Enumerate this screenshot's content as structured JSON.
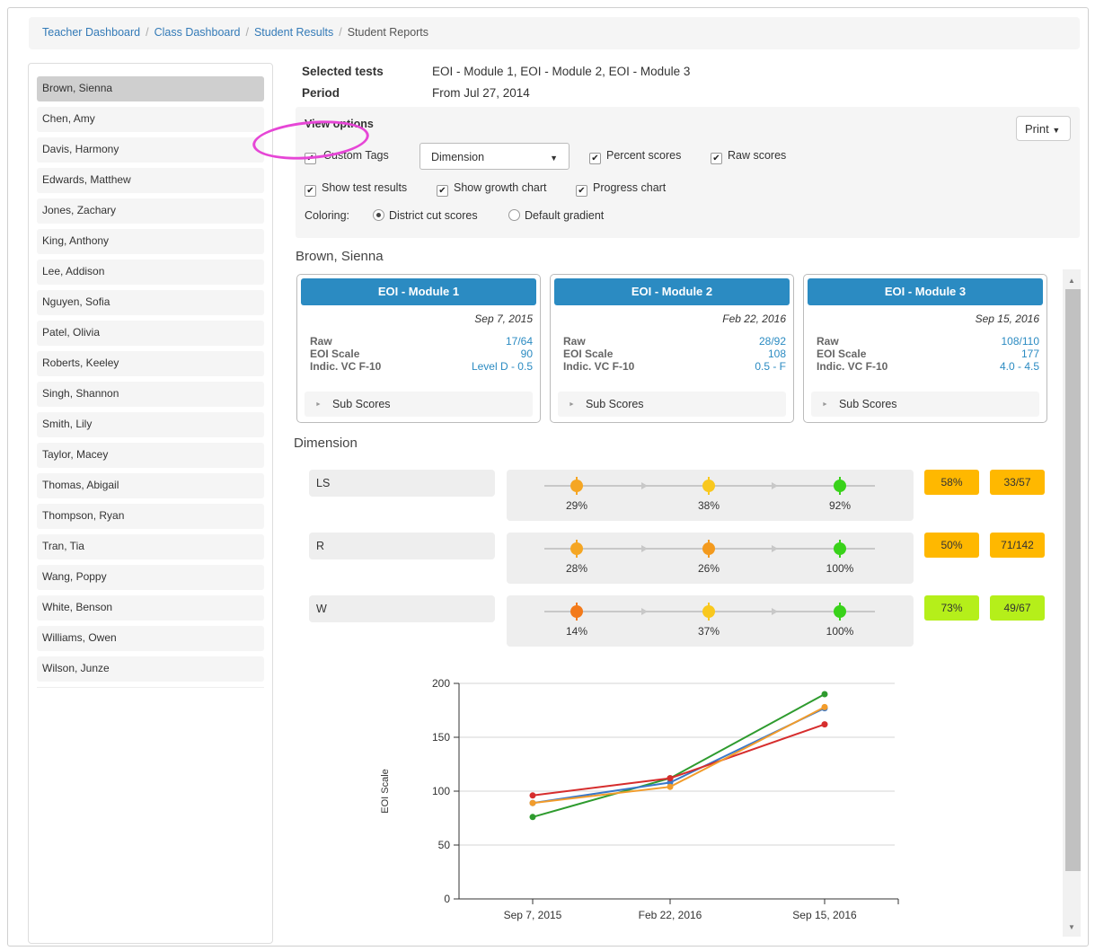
{
  "breadcrumb": {
    "items": [
      "Teacher Dashboard",
      "Class Dashboard",
      "Student Results"
    ],
    "current": "Student Reports"
  },
  "students": [
    "Brown, Sienna",
    "Chen, Amy",
    "Davis, Harmony",
    "Edwards, Matthew",
    "Jones, Zachary",
    "King, Anthony",
    "Lee, Addison",
    "Nguyen, Sofia",
    "Patel, Olivia",
    "Roberts, Keeley",
    "Singh, Shannon",
    "Smith, Lily",
    "Taylor, Macey",
    "Thomas, Abigail",
    "Thompson, Ryan",
    "Tran, Tia",
    "Wang, Poppy",
    "White, Benson",
    "Williams, Owen",
    "Wilson, Junze"
  ],
  "selected_student_index": 0,
  "selection": {
    "tests_label": "Selected tests",
    "tests_value": "EOI - Module 1, EOI - Module 2, EOI - Module 3",
    "period_label": "Period",
    "period_value": "From Jul 27, 2014"
  },
  "view_options": {
    "title": "View options",
    "custom_tags": "Custom Tags",
    "select_value": "Dimension",
    "percent_scores": "Percent scores",
    "raw_scores": "Raw scores",
    "show_test_results": "Show test results",
    "show_growth_chart": "Show growth chart",
    "progress_chart": "Progress chart",
    "coloring_label": "Coloring:",
    "district_cut_scores": "District cut scores",
    "default_gradient": "Default gradient",
    "print_label": "Print"
  },
  "student_name": "Brown, Sienna",
  "dimension_heading": "Dimension",
  "tests": [
    {
      "title": "EOI - Module 1",
      "date": "Sep 7, 2015",
      "rows": [
        {
          "k": "Raw",
          "v": "17/64"
        },
        {
          "k": "EOI Scale",
          "v": "90"
        },
        {
          "k": "Indic. VC F-10",
          "v": "Level D - 0.5"
        }
      ],
      "sub_scores": "Sub Scores"
    },
    {
      "title": "EOI - Module 2",
      "date": "Feb 22, 2016",
      "rows": [
        {
          "k": "Raw",
          "v": "28/92"
        },
        {
          "k": "EOI Scale",
          "v": "108"
        },
        {
          "k": "Indic. VC F-10",
          "v": "0.5 - F"
        }
      ],
      "sub_scores": "Sub Scores"
    },
    {
      "title": "EOI - Module 3",
      "date": "Sep 15, 2016",
      "rows": [
        {
          "k": "Raw",
          "v": "108/110"
        },
        {
          "k": "EOI Scale",
          "v": "177"
        },
        {
          "k": "Indic. VC F-10",
          "v": "4.0 - 4.5"
        }
      ],
      "sub_scores": "Sub Scores"
    }
  ],
  "dimensions": [
    {
      "label": "LS",
      "points": [
        {
          "value": "29%",
          "color": "#f5a623"
        },
        {
          "value": "38%",
          "color": "#f9c81e"
        },
        {
          "value": "92%",
          "color": "#39d21a"
        }
      ],
      "percent": "58%",
      "raw": "33/57",
      "badge_color": "#ffb800"
    },
    {
      "label": "R",
      "points": [
        {
          "value": "28%",
          "color": "#f5a623"
        },
        {
          "value": "26%",
          "color": "#f39a1e"
        },
        {
          "value": "100%",
          "color": "#39d21a"
        }
      ],
      "percent": "50%",
      "raw": "71/142",
      "badge_color": "#ffb800"
    },
    {
      "label": "W",
      "points": [
        {
          "value": "14%",
          "color": "#f37a1a"
        },
        {
          "value": "37%",
          "color": "#f9c81e"
        },
        {
          "value": "100%",
          "color": "#39d21a"
        }
      ],
      "percent": "73%",
      "raw": "49/67",
      "badge_color": "#b5ef1a"
    }
  ],
  "chart_data": {
    "type": "line",
    "title": "",
    "xlabel": "",
    "ylabel": "EOI Scale",
    "categories": [
      "Sep 7, 2015",
      "Feb 22, 2016",
      "Sep 15, 2016"
    ],
    "ylim": [
      0,
      200
    ],
    "yticks": [
      0,
      50,
      100,
      150,
      200
    ],
    "grid": true,
    "series": [
      {
        "color": "#2e9b2e",
        "values": [
          76,
          112,
          190
        ]
      },
      {
        "color": "#3a78c8",
        "values": [
          89,
          108,
          177
        ]
      },
      {
        "color": "#d62d2d",
        "values": [
          96,
          112,
          162
        ]
      },
      {
        "color": "#f29c2b",
        "values": [
          89,
          104,
          178
        ]
      }
    ]
  }
}
